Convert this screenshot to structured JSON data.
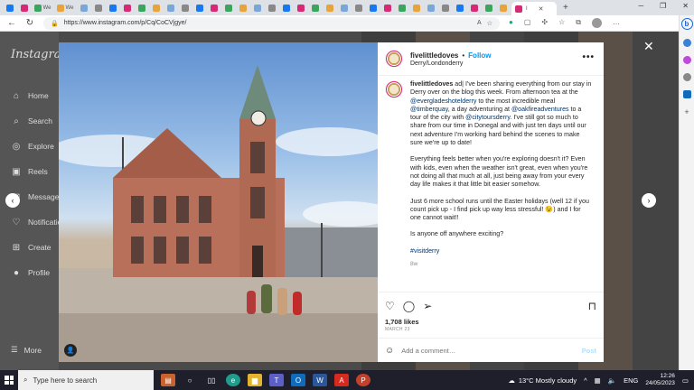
{
  "browser": {
    "url": "https://www.instagram.com/p/Cq/CoCVjgye/",
    "active_tab_label": "I",
    "tab_close": "✕",
    "new_tab": "+",
    "tab_labels": [
      "",
      "",
      "We",
      "We",
      "",
      "",
      "",
      "",
      "",
      "",
      "",
      "",
      "",
      "",
      "",
      "",
      "",
      "",
      "",
      "",
      "",
      "",
      "",
      "",
      "",
      "",
      "",
      "",
      "",
      "",
      "",
      "",
      "",
      ""
    ]
  },
  "instagram": {
    "logo": "Instagram",
    "nav": [
      {
        "label": "Home",
        "icon": "⌂"
      },
      {
        "label": "Search",
        "icon": "⌕"
      },
      {
        "label": "Explore",
        "icon": "◎"
      },
      {
        "label": "Reels",
        "icon": "▣"
      },
      {
        "label": "Messages",
        "icon": "✉"
      },
      {
        "label": "Notifications",
        "icon": "♡"
      },
      {
        "label": "Create",
        "icon": "⊞"
      },
      {
        "label": "Profile",
        "icon": "●"
      }
    ],
    "more_label": "More"
  },
  "post": {
    "username": "fivelittledoves",
    "separator": "•",
    "follow_label": "Follow",
    "location": "Derry/Londonderry",
    "caption": {
      "username": "fivelittledoves",
      "para1_a": " ad| I've been sharing everything from our stay in Derry over on the blog this week. From afternoon tea at the ",
      "link1": "@evergladeshotelderry",
      "para1_b": " to the most incredible meal ",
      "link2": "@timberquay",
      "para1_c": ", a day adventuring at ",
      "link3": "@oakfireadventures",
      "para1_d": " to a tour of the city with ",
      "link4": "@citytoursderry",
      "para1_e": ". I've still got so much to share from our time in Donegal and with just ten days until our next adventure I'm working hard behind the scenes to make sure we're up to date!",
      "para2": "Everything feels better when you're exploring doesn't it? Even with kids, even when the weather isn't great, even when you're not doing all that much at all, just being away from your every day life makes it that little bit easier somehow.",
      "para3": "Just 6 more school runs until the Easter holidays (well 12 if you count pick up - I find pick up way less stressful! 😉) and I for one cannot wait!!",
      "para4": "Is anyone off anywhere exciting?",
      "hashtag": "#visitderry",
      "time": "8w"
    },
    "likes": "1,708 likes",
    "date": "MARCH 23",
    "comment_placeholder": "Add a comment…",
    "post_label": "Post"
  },
  "taskbar": {
    "search_placeholder": "Type here to search",
    "weather": "13°C  Mostly cloudy",
    "lang": "ENG",
    "time": "12:26",
    "date": "24/05/2023"
  },
  "colors": {
    "accent": "#0095f6",
    "link": "#00376b",
    "post_disabled": "#b2dffc"
  }
}
